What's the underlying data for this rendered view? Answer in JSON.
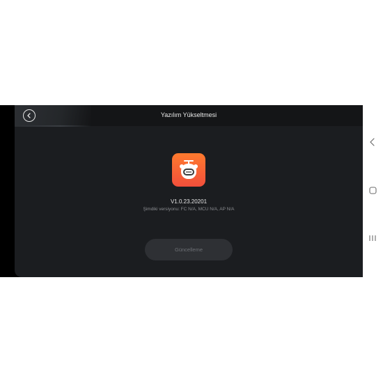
{
  "header": {
    "title": "Yazılım Yükseltmesi"
  },
  "main": {
    "version": "V1.0.23.20201",
    "current_versions": "Şimdiki versiyonu: FC N/A, MCU N/A, AP N/A",
    "update_button_label": "Güncelleme"
  },
  "icons": {
    "back": "back-arrow-icon",
    "app": "robot-app-icon",
    "nav_back": "nav-back-icon",
    "nav_home": "nav-home-icon",
    "nav_recents": "nav-recents-icon"
  },
  "colors": {
    "screen_bg": "#1b1d20",
    "header_bg": "#141517",
    "app_icon_top": "#ff7a2e",
    "app_icon_bottom": "#f24f3b",
    "button_bg": "#2e3034",
    "button_text": "#6d7075"
  }
}
